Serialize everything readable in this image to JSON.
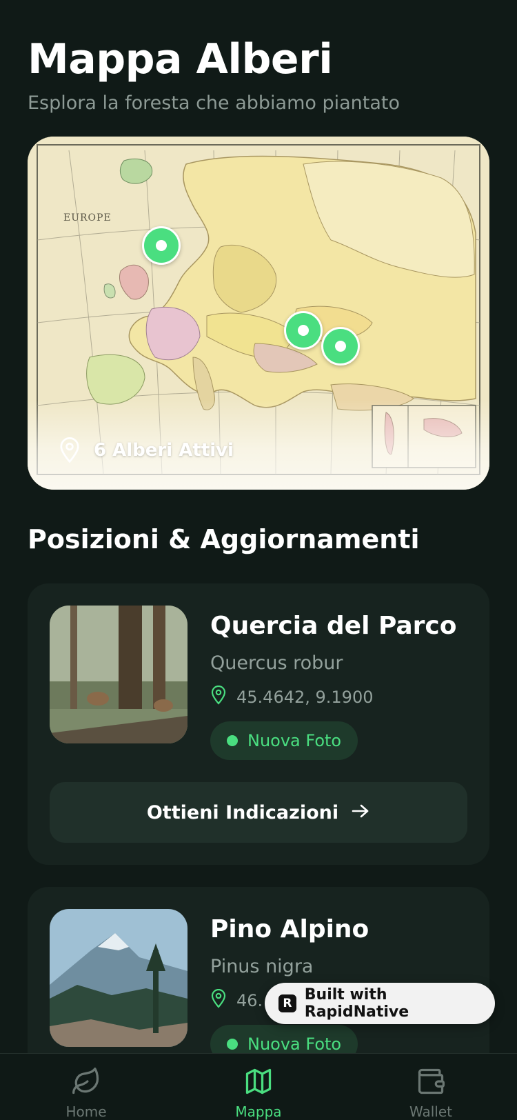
{
  "header": {
    "title": "Mappa Alberi",
    "subtitle": "Esplora la foresta che abbiamo piantato"
  },
  "map": {
    "active_label": "6 Alberi Attivi",
    "image_description_icon": "map-pin-icon",
    "marker_color": "#4ade80"
  },
  "section": {
    "title": "Posizioni & Aggiornamenti"
  },
  "trees": [
    {
      "name": "Quercia del Parco",
      "latin": "Quercus robur",
      "coords": "45.4642, 9.1900",
      "badge": "Nuova Foto",
      "button": "Ottieni Indicazioni"
    },
    {
      "name": "Pino Alpino",
      "latin": "Pinus nigra",
      "coords": "46.",
      "badge": "Nuova Foto"
    }
  ],
  "rapidnative": {
    "label": "Built with RapidNative"
  },
  "tabs": [
    {
      "label": "Home",
      "icon": "leaf-icon"
    },
    {
      "label": "Mappa",
      "icon": "map-icon"
    },
    {
      "label": "Wallet",
      "icon": "wallet-icon"
    }
  ],
  "colors": {
    "background": "#101a17",
    "card": "#17231f",
    "accent": "#4ade80"
  }
}
